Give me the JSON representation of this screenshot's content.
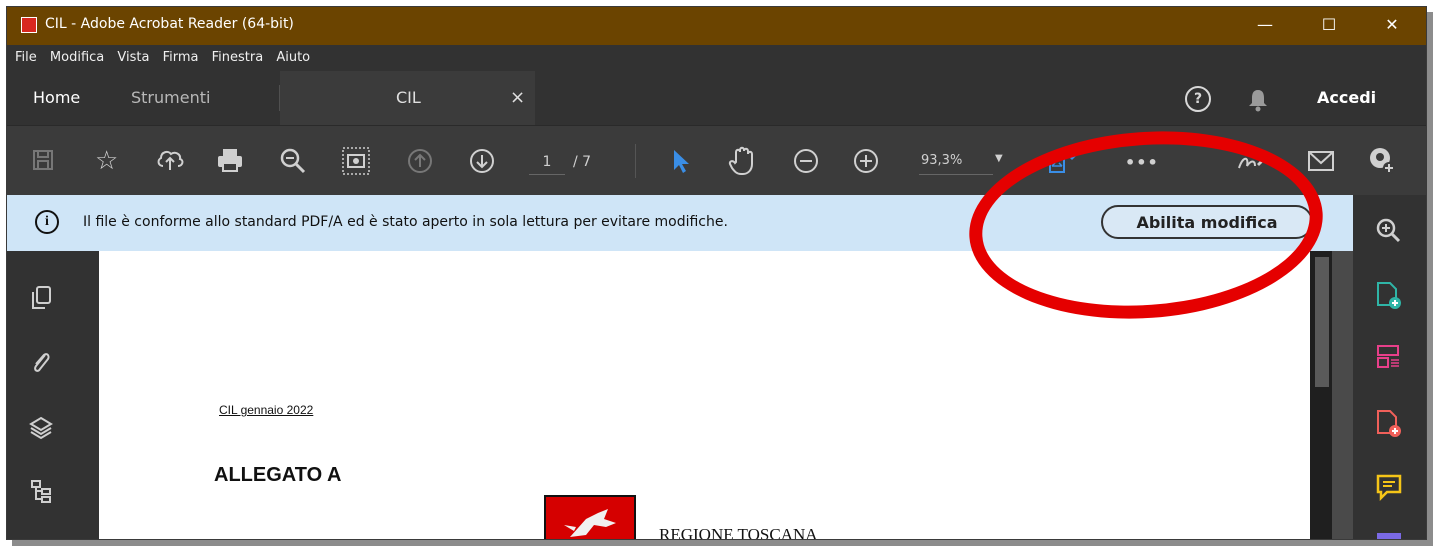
{
  "window": {
    "title": "CIL - Adobe Acrobat Reader (64-bit)",
    "minimize": "—",
    "maximize": "☐",
    "close": "✕"
  },
  "menu": [
    "File",
    "Modifica",
    "Vista",
    "Firma",
    "Finestra",
    "Aiuto"
  ],
  "tabs": {
    "home": "Home",
    "tools": "Strumenti",
    "document": "CIL",
    "close": "×",
    "signin": "Accedi",
    "help": "?"
  },
  "toolbar": {
    "page_current": "1",
    "page_total": "/ 7",
    "zoom": "93,3%",
    "more": "•••"
  },
  "infobar": {
    "icon": "i",
    "message": "Il file è conforme allo standard PDF/A ed è stato aperto in sola lettura per evitare modifiche.",
    "button": "Abilita modifica"
  },
  "document": {
    "header": "CIL gennaio 2022",
    "heading": "ALLEGATO A",
    "org": "REGIONE TOSCANA"
  },
  "colors": {
    "titlebar": "#6b4400",
    "accent": "#3a8ee6",
    "highlight_circle": "#e50000",
    "infobar": "#cfe5f7"
  }
}
